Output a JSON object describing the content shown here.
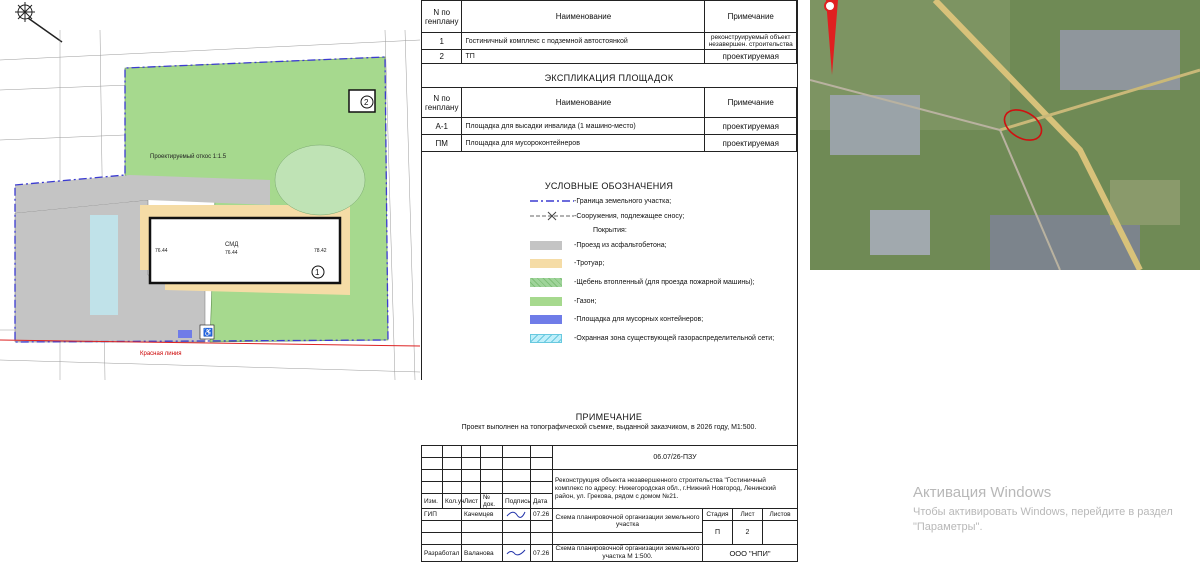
{
  "explication_buildings": {
    "headers": [
      "N по генплану",
      "Наименование",
      "Примечание"
    ],
    "rows": [
      {
        "num": "1",
        "name": "Гостиничный комплекс с подземной автостоянкой",
        "note": "реконструируемый объект незавершен. строительства"
      },
      {
        "num": "2",
        "name": "ТП",
        "note": "проектируемая"
      }
    ]
  },
  "explication_sites": {
    "title": "ЭКСПЛИКАЦИЯ ПЛОЩАДОК",
    "headers": [
      "N по генплану",
      "Наименование",
      "Примечание"
    ],
    "rows": [
      {
        "num": "А-1",
        "name": "Площадка для высадки инвалида (1 машино-место)",
        "note": "проектируемая"
      },
      {
        "num": "ПМ",
        "name": "Площадка для мусороконтейнеров",
        "note": "проектируемая"
      }
    ]
  },
  "legend": {
    "title": "УСЛОВНЫЕ ОБОЗНАЧЕНИЯ",
    "boundary": "-Граница земельного участка;",
    "demolish": "-Сооружения, подлежащее сносу;",
    "coverings": "Покрытия:",
    "items": [
      {
        "label": "-Проезд из асфальтобетона;",
        "color": "#c4c4c4"
      },
      {
        "label": "-Тротуар;",
        "color": "#f5dca6"
      },
      {
        "label": "-Щебень втопленный (для проезда пожарной машины);",
        "color": "#9fd49a"
      },
      {
        "label": "-Газон;",
        "color": "#a6d98e"
      },
      {
        "label": "-Площадка для мусорных контейнеров;",
        "color": "#6f7ce8"
      },
      {
        "label": "-Охранная зона существующей газораспределительной сети;",
        "color": "#bfeffa"
      }
    ]
  },
  "note": {
    "title": "ПРИМЕЧАНИЕ",
    "text": "Проект выполнен на топографической съемке, выданной заказчиком, в 2026 году, М1:500."
  },
  "stamp": {
    "code": "06.07/26-ПЗУ",
    "project": "Реконструкция объекта незавершенного строительства \"Гостиничный комплекс по адресу: Нижегородская обл., г.Нижний Новгород, Ленинский район, ул. Грекова, рядом с домом №21.",
    "cols": [
      "Изм.",
      "Кол.уч",
      "Лист",
      "№ док.",
      "Подпись",
      "Дата"
    ],
    "stage_h": "Стадия",
    "sheet_h": "Лист",
    "sheets_h": "Листов",
    "stage": "П",
    "sheet": "2",
    "gip_role": "ГИП",
    "gip_name": "Качемцев",
    "gip_date": "07.26",
    "dev_role": "Разработал",
    "dev_name": "Валанова",
    "dev_date": "07.26",
    "scheme1": "Схема планировочной организации земельного участка",
    "scheme2": "Схема планировочной организации земельного участка М 1:500.",
    "org": "ООО \"НПИ\""
  },
  "plan": {
    "label_slope": "Проектируемый откос 1:1.5",
    "label_red_line": "Красная линия",
    "building_num": "1",
    "tp_num": "2",
    "elev1": "76.44",
    "elev2": "76.44",
    "elev3": "78.42"
  },
  "watermark": {
    "title": "Активация Windows",
    "text": "Чтобы активировать Windows, перейдите в раздел \"Параметры\"."
  }
}
